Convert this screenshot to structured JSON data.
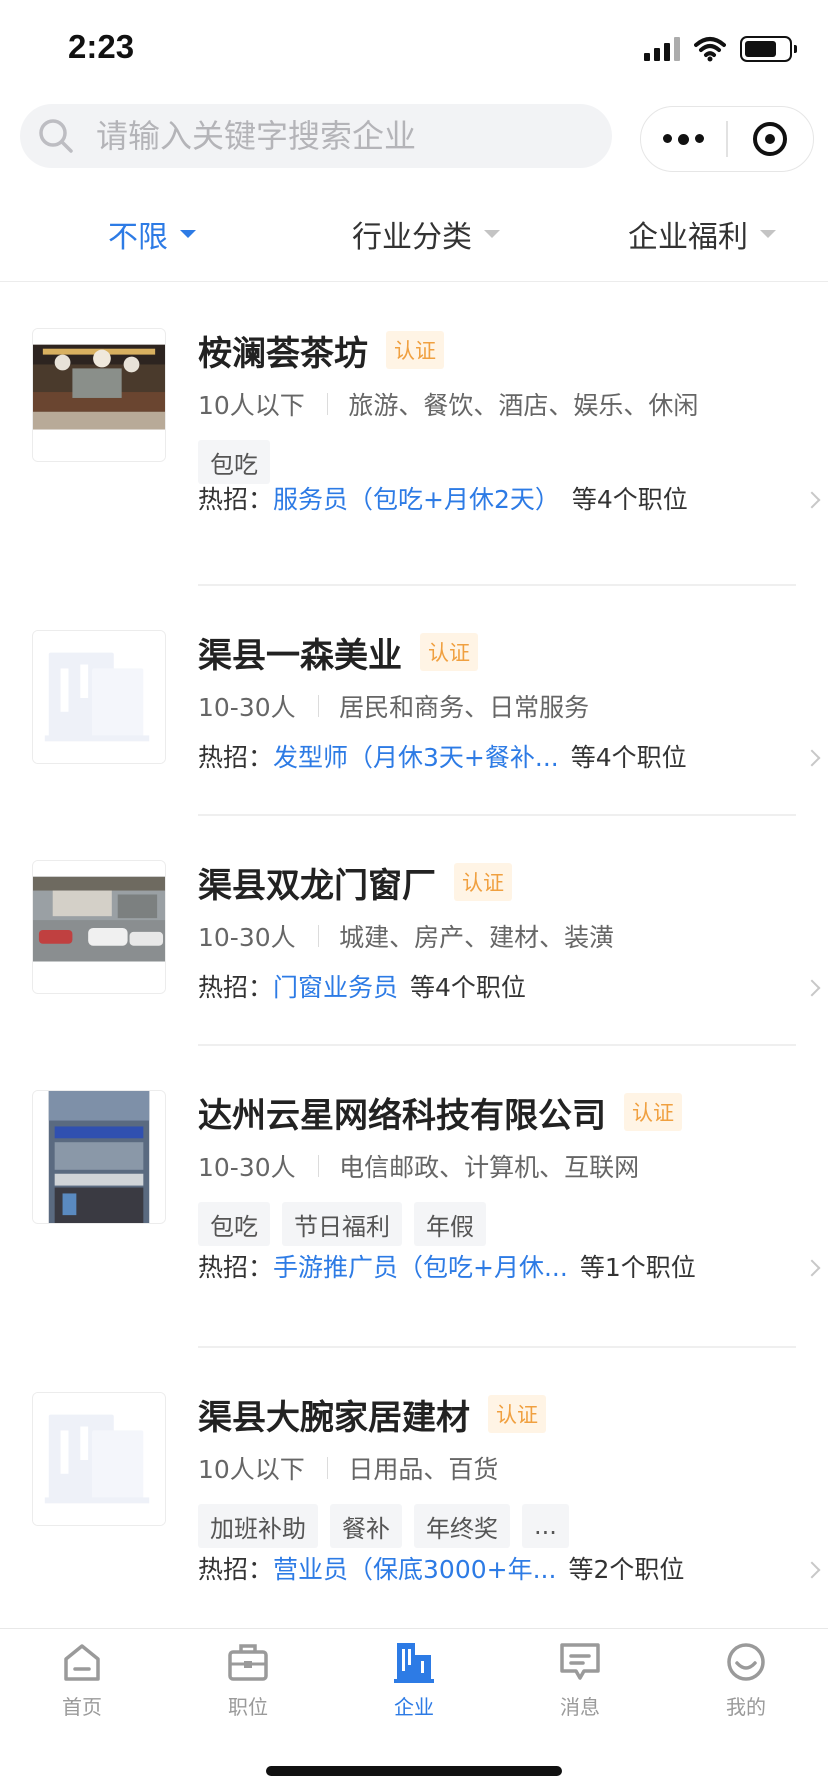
{
  "status_bar": {
    "time": "2:23"
  },
  "search": {
    "placeholder": "请输入关键字搜索企业"
  },
  "filters": [
    {
      "label": "不限",
      "active": true
    },
    {
      "label": "行业分类",
      "active": false
    },
    {
      "label": "企业福利",
      "active": false
    }
  ],
  "companies": [
    {
      "name": "桉澜荟茶坊",
      "cert": "认证",
      "size": "10人以下",
      "industry": "旅游、餐饮、酒店、娱乐、休闲",
      "tags": [
        "包吃"
      ],
      "hot_label": "热招：",
      "hot_job": "服务员（包吃+月休2天）",
      "hot_count": "等4个职位",
      "logo": "photo-teahouse"
    },
    {
      "name": "渠县一森美业",
      "cert": "认证",
      "size": "10-30人",
      "industry": "居民和商务、日常服务",
      "tags": [],
      "hot_label": "热招：",
      "hot_job": "发型师（月休3天+餐补...",
      "hot_count": "等4个职位",
      "logo": "placeholder-building-icon"
    },
    {
      "name": "渠县双龙门窗厂",
      "cert": "认证",
      "size": "10-30人",
      "industry": "城建、房产、建材、装潢",
      "tags": [],
      "hot_label": "热招：",
      "hot_job": "门窗业务员",
      "hot_count": "等4个职位",
      "logo": "photo-factory"
    },
    {
      "name": "达州云星网络科技有限公司",
      "cert": "认证",
      "size": "10-30人",
      "industry": "电信邮政、计算机、互联网",
      "tags": [
        "包吃",
        "节日福利",
        "年假"
      ],
      "hot_label": "热招：",
      "hot_job": "手游推广员（包吃+月休...",
      "hot_count": "等1个职位",
      "logo": "photo-office-building"
    },
    {
      "name": "渠县大腕家居建材",
      "cert": "认证",
      "size": "10人以下",
      "industry": "日用品、百货",
      "tags": [
        "加班补助",
        "餐补",
        "年终奖",
        "..."
      ],
      "hot_label": "热招：",
      "hot_job": "营业员（保底3000+年...",
      "hot_count": "等2个职位",
      "logo": "placeholder-building-icon"
    }
  ],
  "tabs": [
    {
      "label": "首页",
      "icon": "home-icon",
      "active": false
    },
    {
      "label": "职位",
      "icon": "briefcase-icon",
      "active": false
    },
    {
      "label": "企业",
      "icon": "company-icon",
      "active": true
    },
    {
      "label": "消息",
      "icon": "message-icon",
      "active": false
    },
    {
      "label": "我的",
      "icon": "profile-icon",
      "active": false
    }
  ],
  "colors": {
    "accent": "#2d7be5",
    "cert_bg": "#fff4e5",
    "cert_text": "#f0a040",
    "muted": "#9a9a9a"
  }
}
